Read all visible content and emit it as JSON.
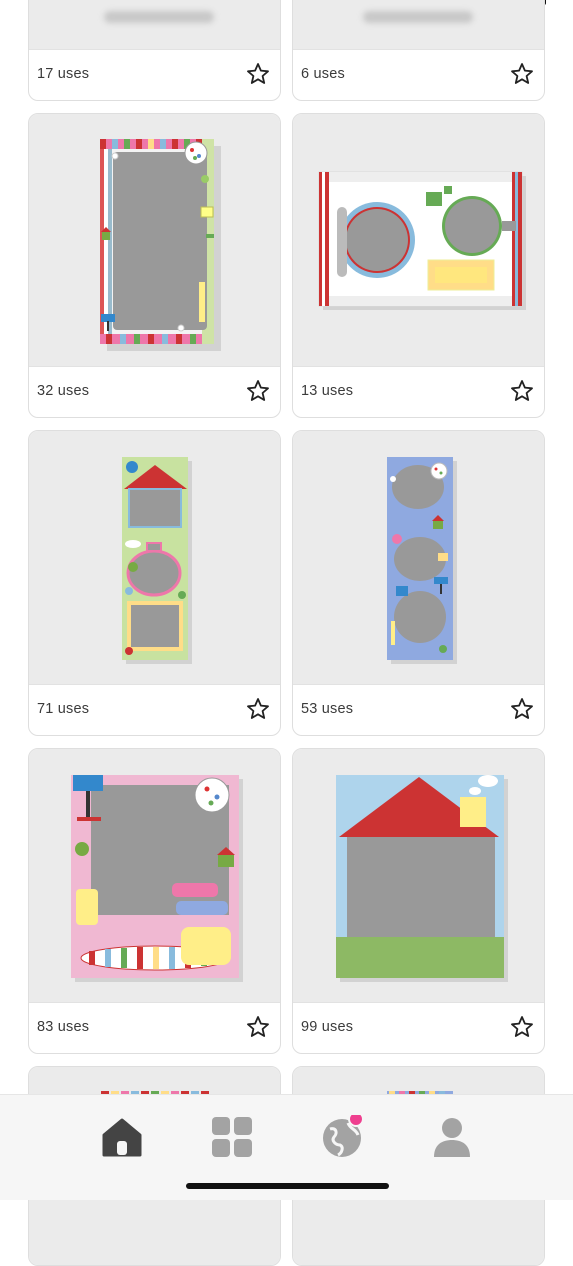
{
  "cards": [
    {
      "uses": "17 uses",
      "favorite": false
    },
    {
      "uses": "6 uses",
      "favorite": false
    },
    {
      "uses": "32 uses",
      "favorite": false
    },
    {
      "uses": "13 uses",
      "favorite": false
    },
    {
      "uses": "71 uses",
      "favorite": false
    },
    {
      "uses": "53 uses",
      "favorite": false
    },
    {
      "uses": "83 uses",
      "favorite": false
    },
    {
      "uses": "99 uses",
      "favorite": false
    }
  ],
  "tabbar": {
    "items": [
      {
        "name": "home",
        "icon": "home-icon",
        "active": true
      },
      {
        "name": "templates",
        "icon": "grid-icon",
        "active": false
      },
      {
        "name": "explore",
        "icon": "globe-icon",
        "active": false,
        "badge": true
      },
      {
        "name": "profile",
        "icon": "person-icon",
        "active": false
      }
    ]
  },
  "colors": {
    "active_icon": "#444444",
    "inactive_icon": "#a3a3a3",
    "badge": "#ef3f8f",
    "card_bg": "#ebebeb"
  }
}
